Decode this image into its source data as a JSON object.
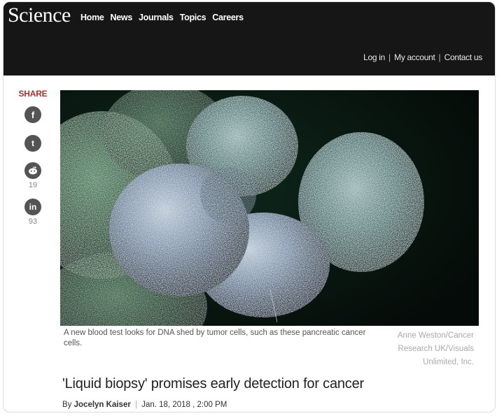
{
  "header": {
    "logo": "Science",
    "nav": [
      "Home",
      "News",
      "Journals",
      "Topics",
      "Careers"
    ],
    "account_links": [
      "Log in",
      "My account",
      "Contact us"
    ],
    "account_separators": [
      "|",
      "|"
    ]
  },
  "share": {
    "title": "SHARE",
    "facebook_glyph": "f",
    "twitter_glyph": "t",
    "reddit_count": "19",
    "linkedin_glyph": "in",
    "linkedin_count": "93"
  },
  "article": {
    "caption": "A new blood test looks for DNA shed by tumor cells, such as these pancreatic cancer cells.",
    "credit": "Anne Weston/Cancer Research UK/Visuals Unlimited, Inc.",
    "headline": "'Liquid biopsy' promises early detection for cancer",
    "byline_prefix": "By",
    "author": "Jocelyn Kaiser",
    "byline_separator": "|",
    "date": "Jan. 18, 2018 , 2:00 PM"
  },
  "colors": {
    "header_bg": "#161616",
    "share_accent": "#b52a2a",
    "icon_bg": "#545454"
  }
}
